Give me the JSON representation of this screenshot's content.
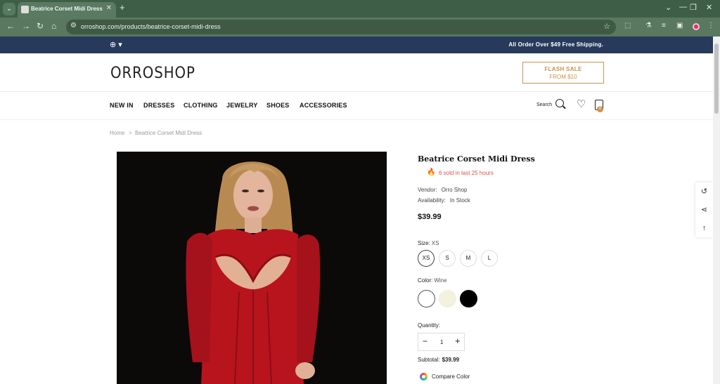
{
  "browser": {
    "tab_title": "Beatrice Corset Midi Dress",
    "url": "orroshop.com/products/beatrice-corset-midi-dress"
  },
  "announcement": {
    "text": "All Order Over $49 Free Shipping."
  },
  "header": {
    "logo": "ORROSHOP",
    "flash_sale_title": "FLASH SALE",
    "flash_sale_sub": "FROM $10"
  },
  "nav": {
    "items": [
      "NEW IN",
      "DRESSES",
      "CLOTHING",
      "JEWELRY",
      "SHOES",
      "ACCESSORIES"
    ],
    "search_label": "Search",
    "cart_count": "0"
  },
  "breadcrumb": {
    "home": "Home",
    "sep": ">",
    "current": "Beatrice Corset Midi Dress"
  },
  "product": {
    "title": "Beatrice Corset Midi Dress",
    "sold_text": "6 sold in last 25 hours",
    "vendor_label": "Vendor:",
    "vendor_value": "Orro Shop",
    "availability_label": "Availability:",
    "availability_value": "In Stock",
    "price": "$39.99",
    "size_label": "Size:",
    "size_value": "XS",
    "sizes": [
      "XS",
      "S",
      "M",
      "L"
    ],
    "color_label": "Color:",
    "color_value": "Wine",
    "colors": [
      "#ffffff",
      "#f4f1dc",
      "#000000"
    ],
    "quantity_label": "Quantity:",
    "quantity": "1",
    "subtotal_label": "Subtotal:",
    "subtotal_value": "$39.99",
    "compare_label": "Compare Color"
  },
  "icons": [
    "globe-icon",
    "search-icon",
    "heart-icon",
    "cart-icon",
    "fire-icon",
    "history-icon",
    "share-icon",
    "back-to-top-icon"
  ]
}
